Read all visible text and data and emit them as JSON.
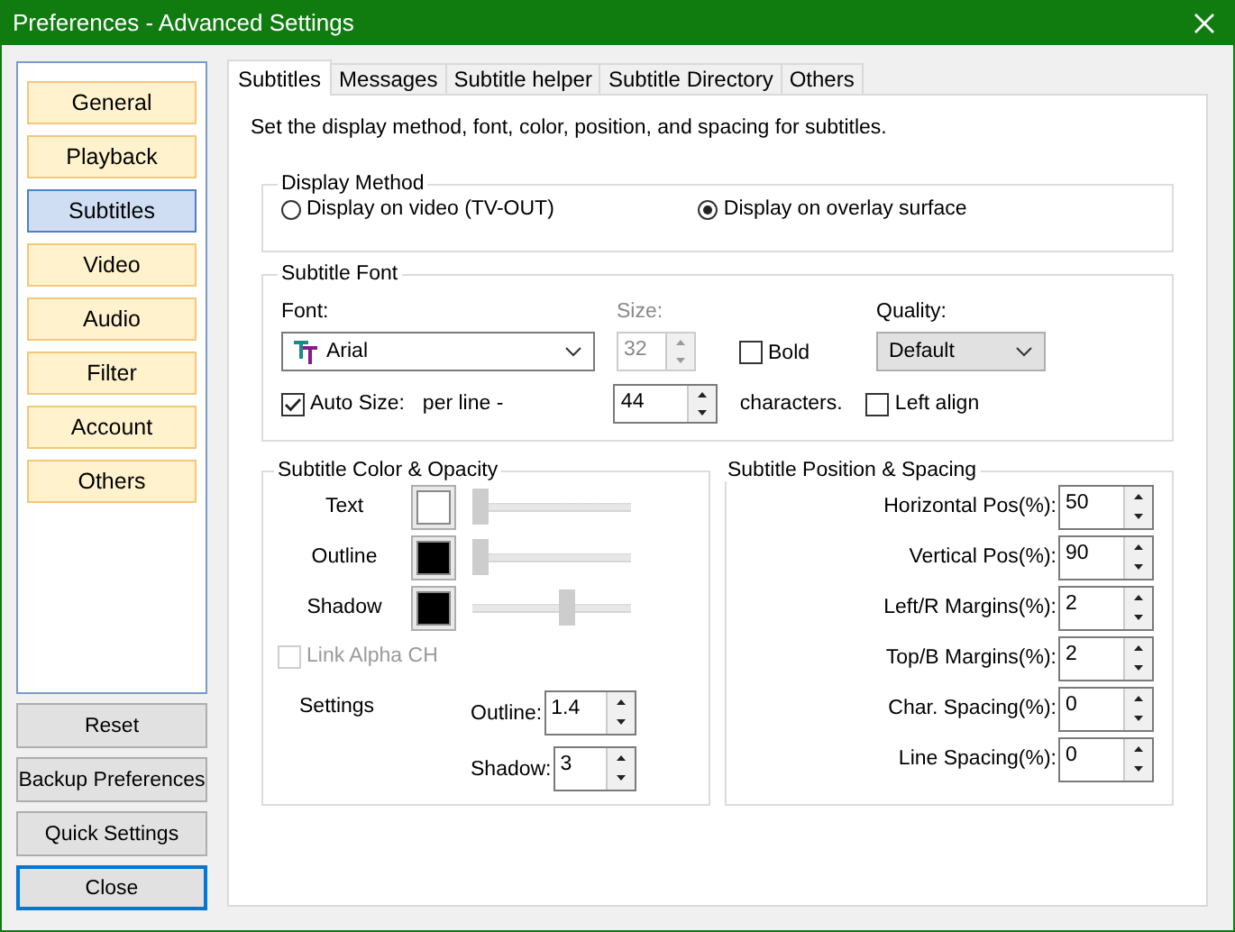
{
  "window": {
    "title": "Preferences - Advanced Settings"
  },
  "sidebar": {
    "items": [
      {
        "label": "General",
        "selected": false
      },
      {
        "label": "Playback",
        "selected": false
      },
      {
        "label": "Subtitles",
        "selected": true
      },
      {
        "label": "Video",
        "selected": false
      },
      {
        "label": "Audio",
        "selected": false
      },
      {
        "label": "Filter",
        "selected": false
      },
      {
        "label": "Account",
        "selected": false
      },
      {
        "label": "Others",
        "selected": false
      }
    ]
  },
  "sidebar_buttons": [
    {
      "label": "Reset",
      "focused": false
    },
    {
      "label": "Backup Preferences",
      "focused": false
    },
    {
      "label": "Quick Settings",
      "focused": false
    },
    {
      "label": "Close",
      "focused": true
    }
  ],
  "tabs": [
    {
      "label": "Subtitles",
      "selected": true
    },
    {
      "label": "Messages",
      "selected": false
    },
    {
      "label": "Subtitle helper",
      "selected": false
    },
    {
      "label": "Subtitle Directory",
      "selected": false
    },
    {
      "label": "Others",
      "selected": false
    }
  ],
  "description": "Set the display method, font, color, position, and spacing for subtitles.",
  "display_method": {
    "title": "Display Method",
    "options": [
      {
        "label": "Display on video (TV-OUT)",
        "selected": false
      },
      {
        "label": "Display on overlay surface",
        "selected": true
      }
    ]
  },
  "subtitle_font": {
    "title": "Subtitle Font",
    "font_label": "Font:",
    "font": "Arial",
    "size_label": "Size:",
    "size": "32",
    "size_disabled": true,
    "bold": {
      "label": "Bold",
      "checked": false
    },
    "quality_label": "Quality:",
    "quality": "Default",
    "auto_size": {
      "label": "Auto Size:",
      "checked": true
    },
    "per_line_label": "per line -",
    "per_line": "44",
    "characters_label": "characters.",
    "left_align": {
      "label": "Left align",
      "checked": false
    }
  },
  "color_opacity": {
    "title": "Subtitle Color & Opacity",
    "rows": [
      {
        "label": "Text",
        "color": "#ffffff",
        "level": 0
      },
      {
        "label": "Outline",
        "color": "#000000",
        "level": 0
      },
      {
        "label": "Shadow",
        "color": "#000000",
        "level": 0.6
      }
    ],
    "link_alpha": {
      "label": "Link Alpha CH",
      "checked": false,
      "disabled": true
    },
    "settings_label": "Settings",
    "settings": [
      {
        "label": "Outline:",
        "value": "1.4"
      },
      {
        "label": "Shadow:",
        "value": "3"
      }
    ]
  },
  "position_spacing": {
    "title": "Subtitle Position & Spacing",
    "fields": [
      {
        "label": "Horizontal Pos(%):",
        "value": "50"
      },
      {
        "label": "Vertical Pos(%):",
        "value": "90"
      },
      {
        "label": "Left/R Margins(%):",
        "value": "2"
      },
      {
        "label": "Top/B Margins(%):",
        "value": "2"
      },
      {
        "label": "Char. Spacing(%):",
        "value": "0"
      },
      {
        "label": "Line Spacing(%):",
        "value": "0"
      }
    ]
  }
}
